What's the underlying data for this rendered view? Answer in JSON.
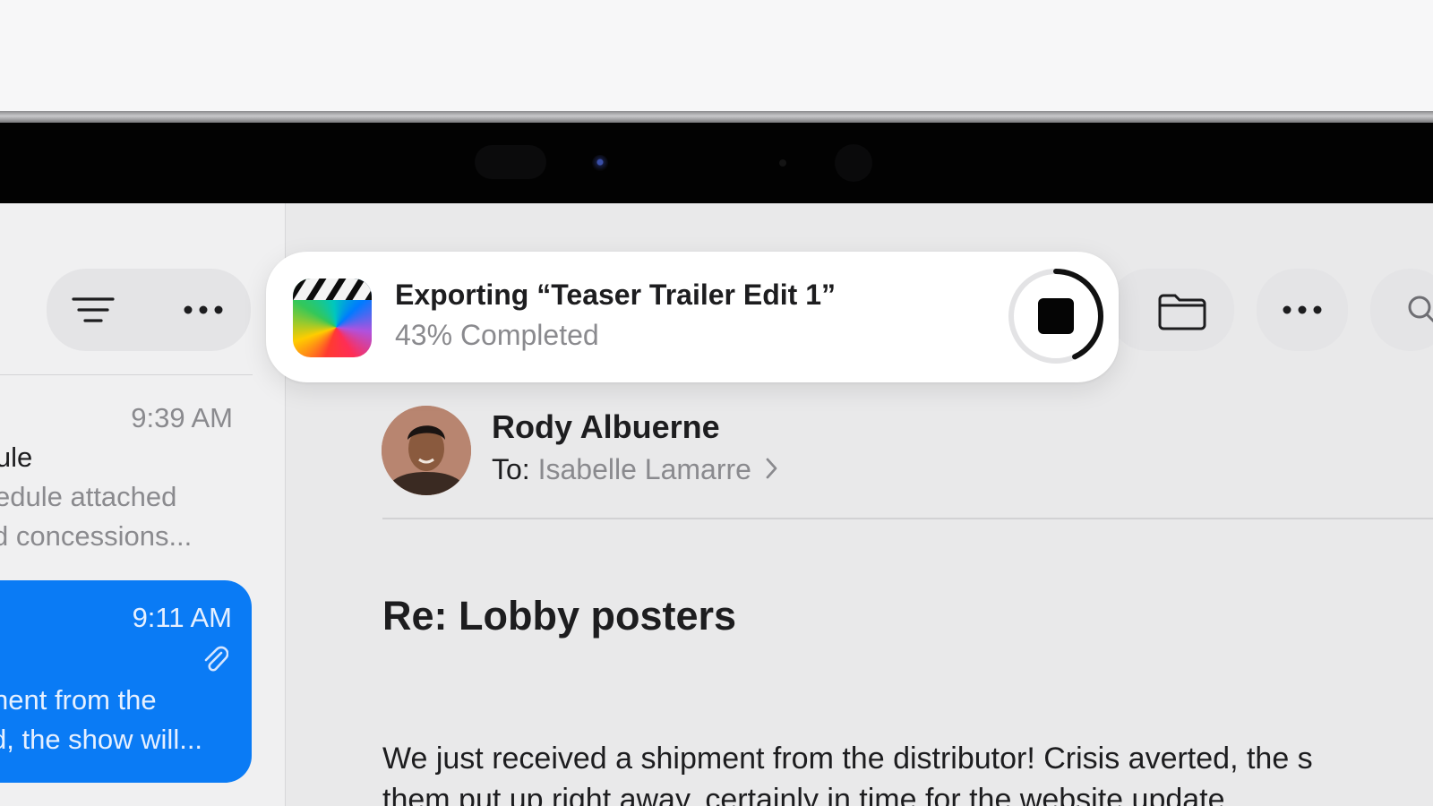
{
  "export": {
    "title": "Exporting “Teaser Trailer Edit 1”",
    "status": "43% Completed",
    "progress": 0.43,
    "app_icon": "final-cut-pro-icon"
  },
  "sidebar": {
    "items": [
      {
        "time": "9:39 AM",
        "subject_fragment": "lule",
        "preview_line1": "edule attached",
        "preview_line2": "d concessions..."
      },
      {
        "time": "9:11 AM",
        "preview_line1": "nent from the",
        "preview_line2": "d, the show will...",
        "selected": true,
        "attachment_icon": "paperclip-icon"
      }
    ]
  },
  "message": {
    "sender": "Rody Albuerne",
    "to_label": "To:",
    "recipient": "Isabelle Lamarre",
    "subject": "Re: Lobby posters",
    "body_line1": "We just received a shipment from the distributor! Crisis averted, the s",
    "body_line2": "them put up right away, certainly in time for the website update"
  },
  "colors": {
    "accent": "#0a7bf5",
    "secondary_text": "#8a8a8e",
    "primary_text": "#1d1d1f"
  }
}
